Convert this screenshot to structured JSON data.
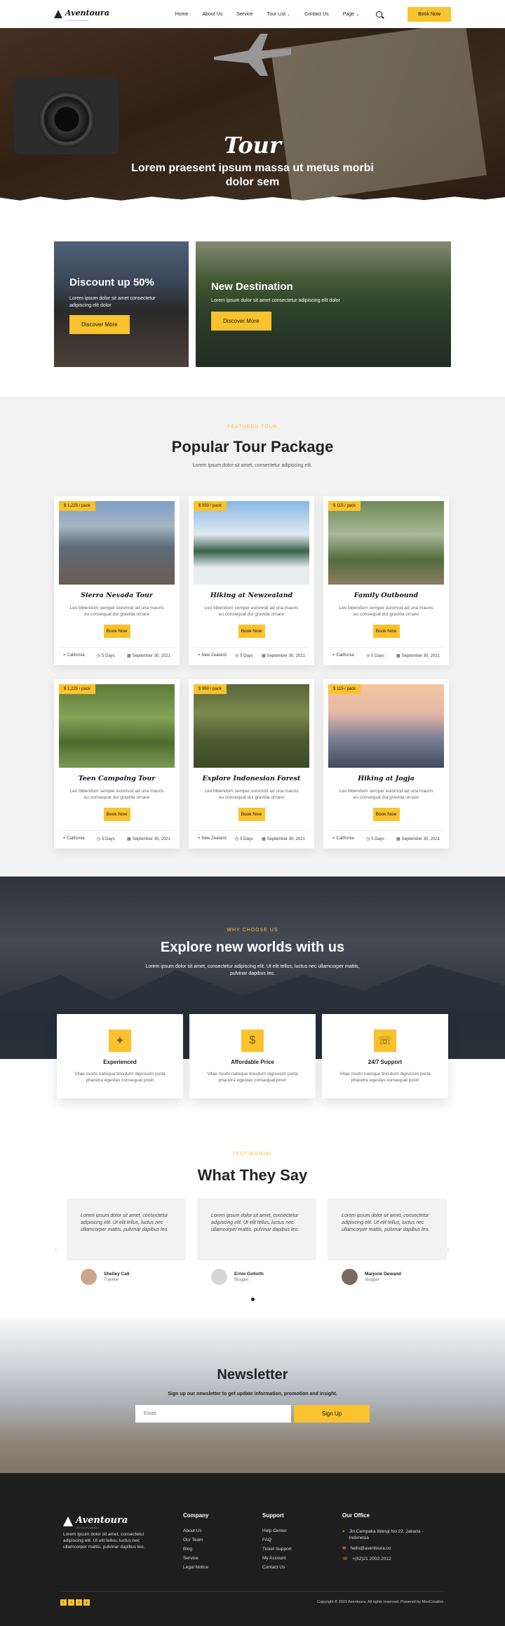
{
  "nav": {
    "logo": "Aventoura",
    "logo_tagline": "Let's Start The Adventure",
    "links": [
      "Home",
      "About Us",
      "Service",
      "Tour List",
      "Contact Us",
      "Page"
    ],
    "cta": "Book Now"
  },
  "hero": {
    "title": "Tour",
    "subtitle": "Lorem praesent ipsum massa ut metus morbi dolor sem"
  },
  "promos": [
    {
      "title": "Discount up 50%",
      "text": "Lorem ipsum dolor sit amet consectetur adipiscing elit dolor",
      "button": "Discover More"
    },
    {
      "title": "New Destination",
      "text": "Lorem ipsum dolor sit amet consectetur adipiscing elit dolor",
      "button": "Discover More"
    }
  ],
  "popular": {
    "eyebrow": "FEATURED TOUR",
    "title": "Popular Tour Package",
    "description": "Lorem ipsum dolor sit amet, consectetur adipiscing elit.",
    "tours": [
      {
        "price": "$ 1,225 / pack",
        "name": "Sierra Nevada Tour",
        "desc": "Leo bibendum semper euismod ad una mauris eu consequat dui gravida ornare",
        "button": "Book Now",
        "location": "California",
        "days": "5 Days",
        "date": "September 30, 2021"
      },
      {
        "price": "$ 950 / pack",
        "name": "Hiking at Newzealand",
        "desc": "Leo bibendum semper euismod ad una mauris eu consequat dui gravida ornare",
        "button": "Book Now",
        "location": "New Zealand",
        "days": "5 Days",
        "date": "September 30, 2021"
      },
      {
        "price": "$ 115 / pack",
        "name": "Family Outbound",
        "desc": "Leo bibendum semper euismod ad una mauris eu consequat dui gravida ornare",
        "button": "Book Now",
        "location": "California",
        "days": "5 Days",
        "date": "September 30, 2021"
      },
      {
        "price": "$ 1,225 / pack",
        "name": "Teen Campaing Tour",
        "desc": "Leo bibendum semper euismod ad una mauris eu consequat dui gravida ornare",
        "button": "Book Now",
        "location": "California",
        "days": "5 Days",
        "date": "September 30, 2021"
      },
      {
        "price": "$ 950 / pack",
        "name": "Explore Indonesian Forest",
        "desc": "Leo bibendum semper euismod ad una mauris eu consequat dui gravida ornare",
        "button": "Book Now",
        "location": "New Zealand",
        "days": "5 Days",
        "date": "September 30, 2021"
      },
      {
        "price": "$ 115 / pack",
        "name": "Hiking at Jogja",
        "desc": "Leo bibendum semper euismod ad una mauris eu consequat dui gravida ornare",
        "button": "Book Now",
        "location": "California",
        "days": "5 Days",
        "date": "September 30, 2021"
      }
    ]
  },
  "why": {
    "eyebrow": "WHY CHOOSE US",
    "title": "Explore new worlds with us",
    "description": "Lorem ipsum dolor sit amet, consectetur adipiscing elit. Ut elit tellus, luctus nec ullamcorper mattis, pulvinar dapibus leo.",
    "features": [
      {
        "icon": "compass-icon",
        "title": "Experienced",
        "desc": "Vitae morbi natoque tincidunt dignissim porta pharetra egestas consequat proin"
      },
      {
        "icon": "price-tag-icon",
        "title": "Affordable Price",
        "desc": "Vitae morbi natoque tincidunt dignissim porta pharetra egestas consequat proin"
      },
      {
        "icon": "support-icon",
        "title": "24/7 Support",
        "desc": "Vitae morbi natoque tincidunt dignissim porta pharetra egestas consequat proin"
      }
    ]
  },
  "testimonial": {
    "eyebrow": "TESTIMONIAL",
    "title": "What They Say",
    "items": [
      {
        "quote": "Lorem ipsum dolor sit amet, consectetur adipiscing elit. Ut elit tellus, luctus nec ullamcorper mattis, pulvinar dapibus leo.",
        "name": "Shelley Call",
        "role": "Traveler"
      },
      {
        "quote": "Lorem ipsum dolor sit amet, consectetur adipiscing elit. Ut elit tellus, luctus nec ullamcorper mattis, pulvinar dapibus leo.",
        "name": "Ernie Goforth",
        "role": "Blogger"
      },
      {
        "quote": "Lorem ipsum dolor sit amet, consectetur adipiscing elit. Ut elit tellus, luctus nec ullamcorper mattis, pulvinar dapibus leo.",
        "name": "Marjorie Dewand",
        "role": "Vlogger"
      }
    ]
  },
  "newsletter": {
    "title": "Newsletter",
    "description": "Sign up our newsletter to get update information, promotion and insight.",
    "placeholder": "Email",
    "button": "Sign Up"
  },
  "footer": {
    "logo": "Aventoura",
    "logo_tagline": "Let's Start The Adventure",
    "about": "Lorem ipsum dolor sit amet, consectetur adipiscing elit. Ut elit tellus, luctus nec ullamcorper mattis, pulvinar dapibus leo.",
    "company_title": "Company",
    "company_links": [
      "About Us",
      "Our Team",
      "Blog",
      "Service",
      "Legal Notice"
    ],
    "support_title": "Support",
    "support_links": [
      "Help Center",
      "FAQ",
      "Ticket Support",
      "My Account",
      "Contact Us"
    ],
    "office_title": "Our Office",
    "address": "Jln Cempaka Wangi No 22, Jakarta - Indonesia",
    "email": "hello@aventoura.co",
    "phone": "+(62)21 2002-2012",
    "copyright": "Copyright © 2021 Aventoura, All rights reserved. Powered by MoxCreative.",
    "socials": [
      "f",
      "i",
      "t",
      "y"
    ]
  },
  "colors": {
    "accent": "#f9c22e",
    "dark": "#1e1e1e",
    "light_bg": "#f2f2f2"
  }
}
